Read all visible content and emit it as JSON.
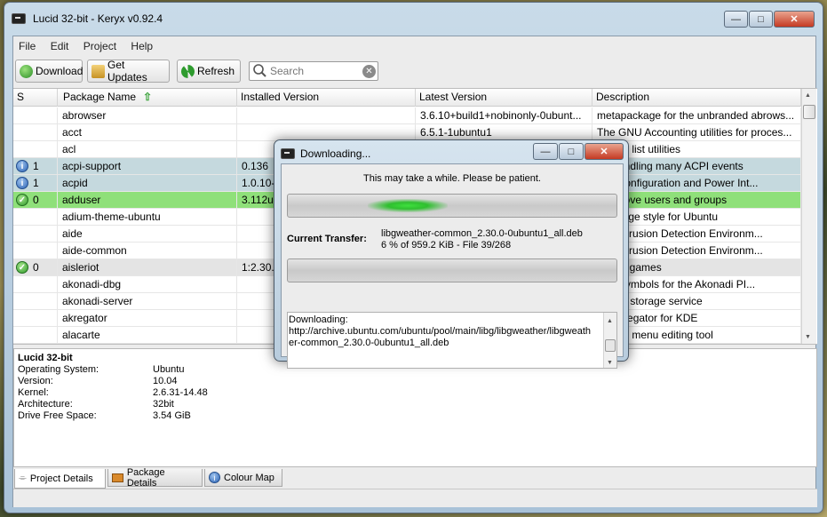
{
  "window": {
    "title": "Lucid 32-bit - Keryx v0.92.4"
  },
  "menu": [
    "File",
    "Edit",
    "Project",
    "Help"
  ],
  "toolbar": {
    "download": "Download",
    "get_updates": "Get Updates",
    "refresh": "Refresh",
    "search_placeholder": "Search"
  },
  "table": {
    "headers": {
      "s": "S",
      "name": "Package Name",
      "installed": "Installed Version",
      "latest": "Latest Version",
      "description": "Description"
    },
    "rows": [
      {
        "status": "",
        "count": "",
        "name": "abrowser",
        "installed": "",
        "latest": "3.6.10+build1+nobinonly-0ubunt...",
        "description": "metapackage for the unbranded abrows...",
        "bg": "#ffffff"
      },
      {
        "status": "",
        "count": "",
        "name": "acct",
        "installed": "",
        "latest": "6.5.1-1ubuntu1",
        "description": "The GNU Accounting utilities for proces...",
        "bg": "#ffffff"
      },
      {
        "status": "",
        "count": "",
        "name": "acl",
        "installed": "",
        "latest": "",
        "description": "control list utilities",
        "bg": "#ffffff"
      },
      {
        "status": "info",
        "count": "1",
        "name": "acpi-support",
        "installed": "0.136",
        "latest": "",
        "description": "for handling many ACPI events",
        "bg": "#c5d9de"
      },
      {
        "status": "info",
        "count": "1",
        "name": "acpid",
        "installed": "1.0.10-",
        "latest": "",
        "description": "ced Configuration and Power Int...",
        "bg": "#c5d9de"
      },
      {
        "status": "ok",
        "count": "0",
        "name": "adduser",
        "installed": "3.112ub",
        "latest": "",
        "description": "d remove users and groups",
        "bg": "#8fe07a"
      },
      {
        "status": "",
        "count": "",
        "name": "adium-theme-ubuntu",
        "installed": "",
        "latest": "",
        "description": "message style for Ubuntu",
        "bg": "#ffffff"
      },
      {
        "status": "",
        "count": "",
        "name": "aide",
        "installed": "",
        "latest": "",
        "description": "ced Intrusion Detection Environm...",
        "bg": "#ffffff"
      },
      {
        "status": "",
        "count": "",
        "name": "aide-common",
        "installed": "",
        "latest": "",
        "description": "ced Intrusion Detection Environm...",
        "bg": "#ffffff"
      },
      {
        "status": "ok",
        "count": "0",
        "name": "aisleriot",
        "installed": "1:2.30.0",
        "latest": "",
        "description": "e card games",
        "bg": "#e4e4e4"
      },
      {
        "status": "",
        "count": "",
        "name": "akonadi-dbg",
        "installed": "",
        "latest": "",
        "description": "ging symbols for the Akonadi PI...",
        "bg": "#ffffff"
      },
      {
        "status": "",
        "count": "",
        "name": "akonadi-server",
        "installed": "",
        "latest": "",
        "description": "di PIM storage service",
        "bg": "#ffffff"
      },
      {
        "status": "",
        "count": "",
        "name": "akregator",
        "installed": "",
        "latest": "",
        "description": "d aggregator for KDE",
        "bg": "#ffffff"
      },
      {
        "status": "",
        "count": "",
        "name": "alacarte",
        "installed": "",
        "latest": "",
        "description": "NOME menu editing tool",
        "bg": "#ffffff"
      }
    ]
  },
  "details": {
    "title": "Lucid 32-bit",
    "items": [
      {
        "label": "Operating System:",
        "value": "Ubuntu"
      },
      {
        "label": "Version:",
        "value": "10.04"
      },
      {
        "label": "Kernel:",
        "value": "2.6.31-14.48"
      },
      {
        "label": "Architecture:",
        "value": "32bit"
      },
      {
        "label": "Drive Free Space:",
        "value": "3.54 GiB"
      }
    ]
  },
  "tabs": [
    "Project Details",
    "Package Details",
    "Colour Map"
  ],
  "dialog": {
    "title": "Downloading...",
    "message": "This may take a while. Please be patient.",
    "current_label": "Current Transfer:",
    "file": "libgweather-common_2.30.0-0ubuntu1_all.deb",
    "progress_text": "6 % of 959.2 KiB - File 39/268",
    "log_lines": [
      "Downloading:",
      "http://archive.ubuntu.com/ubuntu/pool/main/libg/libgweather/libgweath",
      "er-common_2.30.0-0ubuntu1_all.deb"
    ]
  }
}
